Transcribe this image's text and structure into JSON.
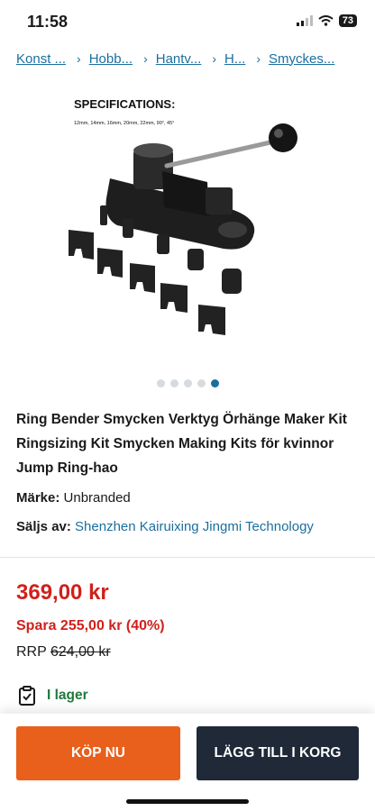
{
  "status_bar": {
    "time": "11:58",
    "battery": "73"
  },
  "breadcrumb": [
    "Konst ...",
    "Hobb...",
    "Hantv...",
    "H...",
    "Smyckes..."
  ],
  "product_image": {
    "spec_title": "SPECIFICATIONS:",
    "spec_line": "12mm, 14mm, 16mm, 20mm, 22mm, 90°, 45°"
  },
  "carousel": {
    "count": 5,
    "active_index": 4
  },
  "product": {
    "title": "Ring Bender Smycken Verktyg Örhänge Maker Kit Ringsizing Kit Smycken Making Kits för kvinnor Jump Ring-hao",
    "brand_label": "Märke:",
    "brand_value": "Unbranded",
    "seller_label": "Säljs av:",
    "seller_value": "Shenzhen Kairuixing Jingmi Technology"
  },
  "pricing": {
    "price": "369,00 kr",
    "savings": "Spara 255,00 kr (40%)",
    "rrp_label": "RRP",
    "rrp_value": "624,00 kr"
  },
  "stock": {
    "label": "I lager"
  },
  "actions": {
    "buy_label": "KÖP NU",
    "cart_label": "LÄGG TILL I KORG"
  },
  "colors": {
    "link": "#1b6f9e",
    "price": "#d0211c",
    "stock": "#1f7a3d",
    "buy_button": "#e8601c",
    "cart_button": "#1f2937"
  }
}
